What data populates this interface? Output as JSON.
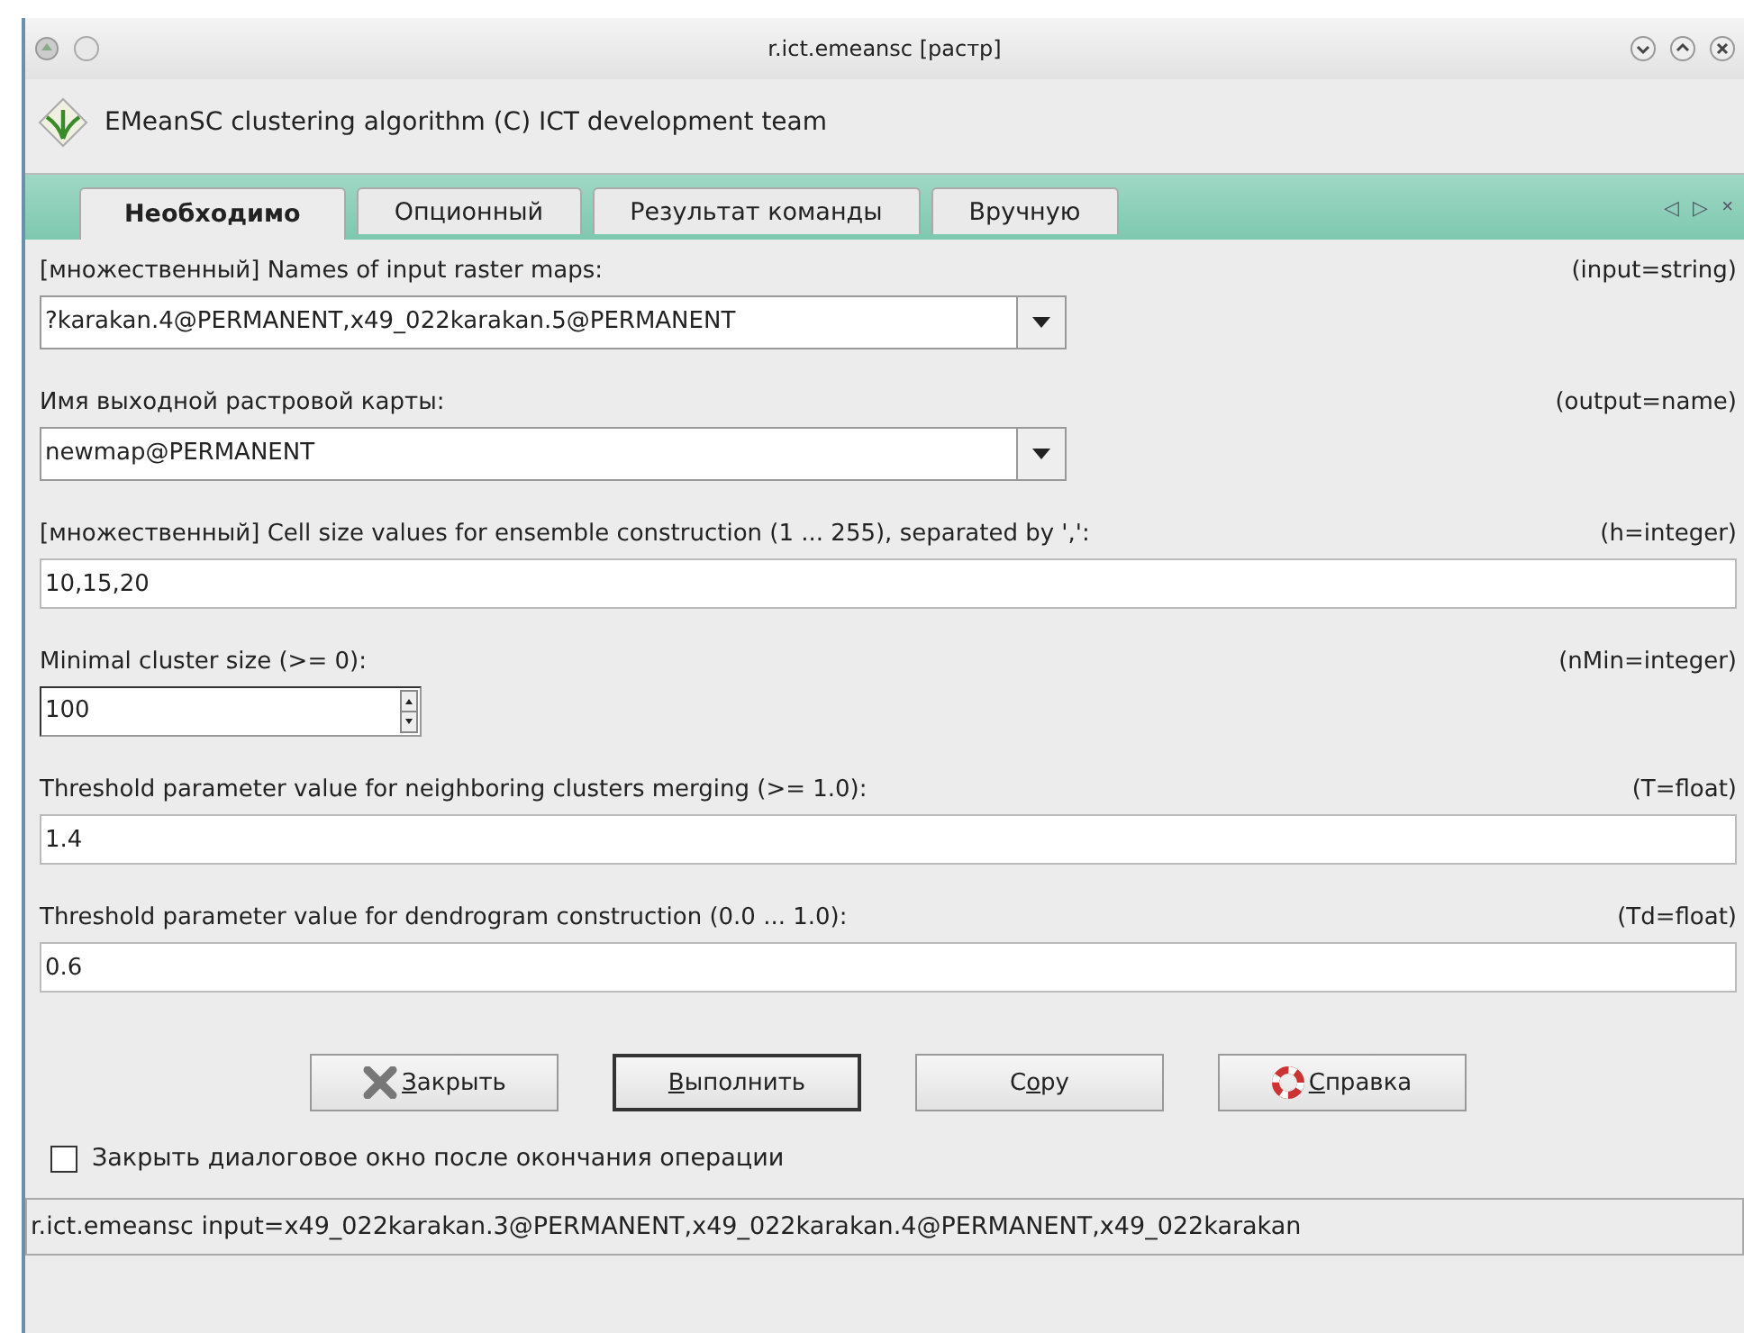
{
  "window": {
    "title": "r.ict.emeansc [растр]"
  },
  "header": {
    "text": "EMeanSC clustering algorithm (C) ICT development team"
  },
  "tabs": [
    {
      "label": "Необходимо",
      "selected": true
    },
    {
      "label": "Опционный",
      "selected": false
    },
    {
      "label": "Результат команды",
      "selected": false
    },
    {
      "label": "Вручную",
      "selected": false
    }
  ],
  "tab_controls": [
    "◁",
    "▷",
    "×"
  ],
  "fields": [
    {
      "kind": "combo",
      "label": "[множественный] Names of input raster maps:",
      "param": "(input=string)",
      "value": "?karakan.4@PERMANENT,x49_022karakan.5@PERMANENT"
    },
    {
      "kind": "combo",
      "label": "Имя выходной растровой карты:",
      "param": "(output=name)",
      "value": "newmap@PERMANENT"
    },
    {
      "kind": "text",
      "label": "[множественный] Cell size values for ensemble construction (1 ... 255), separated by ',':",
      "param": "(h=integer)",
      "value": "10,15,20"
    },
    {
      "kind": "spin",
      "label": "Minimal cluster size (>= 0):",
      "param": "(nMin=integer)",
      "value": "100"
    },
    {
      "kind": "text",
      "label": "Threshold parameter value for neighboring clusters merging (>= 1.0):",
      "param": "(T=float)",
      "value": "1.4"
    },
    {
      "kind": "text",
      "label": "Threshold parameter value for dendrogram construction (0.0 ... 1.0):",
      "param": "(Td=float)",
      "value": "0.6"
    }
  ],
  "buttons": [
    {
      "kind": "close",
      "key": "З",
      "after": "акрыть"
    },
    {
      "kind": "run",
      "key": "В",
      "after": "ыполнить"
    },
    {
      "kind": "copy",
      "before": "C",
      "key": "o",
      "after": "py"
    },
    {
      "kind": "help",
      "key": "С",
      "after": "правка"
    }
  ],
  "close_after": {
    "label": "Закрыть диалоговое окно после окончания операции",
    "checked": false
  },
  "status_bar": {
    "text": "r.ict.emeansc input=x49_022karakan.3@PERMANENT,x49_022karakan.4@PERMANENT,x49_022karakan"
  }
}
